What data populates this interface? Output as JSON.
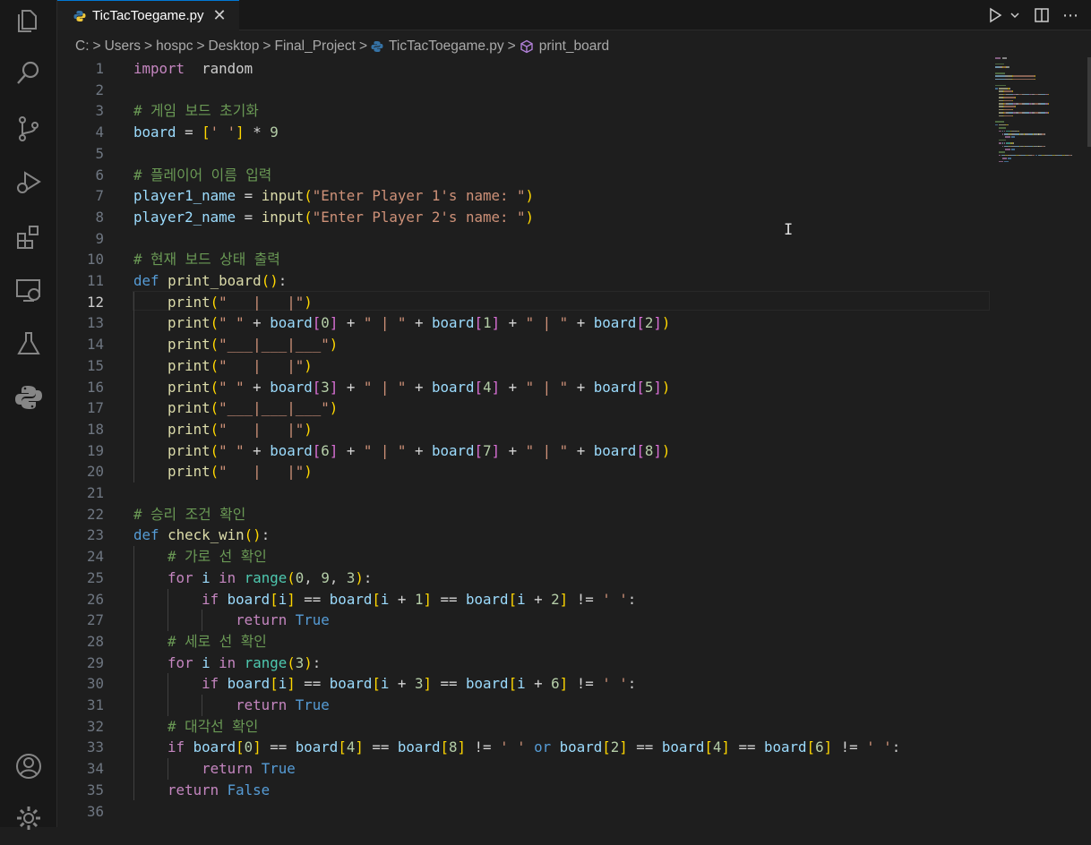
{
  "tab": {
    "title": "TicTacToegame.py",
    "close": "✕"
  },
  "tab_actions": {
    "run": "▷",
    "run_menu": "⌄",
    "split": "◫",
    "more": "⋯"
  },
  "breadcrumb": [
    "C:",
    "Users",
    "hospc",
    "Desktop",
    "Final_Project",
    "TicTacToegame.py",
    "print_board"
  ],
  "breadcrumb_sep": ">",
  "active_line": 12,
  "colors": {
    "background": "#1e1e1e",
    "activitybar": "#181818",
    "accent": "#0078d4",
    "python_blue": "#3572a5"
  },
  "code_lines": [
    [
      [
        "kw",
        "import"
      ],
      [
        "",
        "  "
      ],
      [
        "",
        "random"
      ]
    ],
    [],
    [
      [
        "cm",
        "# 게임 보드 초기화"
      ]
    ],
    [
      [
        "var",
        "board"
      ],
      [
        "op",
        " = "
      ],
      [
        "b1",
        "["
      ],
      [
        "str",
        "' '"
      ],
      [
        "b1",
        "]"
      ],
      [
        "op",
        " * "
      ],
      [
        "num",
        "9"
      ]
    ],
    [],
    [
      [
        "cm",
        "# 플레이어 이름 입력"
      ]
    ],
    [
      [
        "var",
        "player1_name"
      ],
      [
        "op",
        " = "
      ],
      [
        "fn",
        "input"
      ],
      [
        "b1",
        "("
      ],
      [
        "str",
        "\"Enter Player 1's name: \""
      ],
      [
        "b1",
        ")"
      ]
    ],
    [
      [
        "var",
        "player2_name"
      ],
      [
        "op",
        " = "
      ],
      [
        "fn",
        "input"
      ],
      [
        "b1",
        "("
      ],
      [
        "str",
        "\"Enter Player 2's name: \""
      ],
      [
        "b1",
        ")"
      ]
    ],
    [],
    [
      [
        "cm",
        "# 현재 보드 상태 출력"
      ]
    ],
    [
      [
        "def",
        "def"
      ],
      [
        "",
        " "
      ],
      [
        "fn",
        "print_board"
      ],
      [
        "b1",
        "()"
      ],
      [
        "",
        ":"
      ]
    ],
    [
      [
        "",
        "    "
      ],
      [
        "fn",
        "print"
      ],
      [
        "b1",
        "("
      ],
      [
        "str",
        "\"   |   |\""
      ],
      [
        "b1",
        ")"
      ]
    ],
    [
      [
        "",
        "    "
      ],
      [
        "fn",
        "print"
      ],
      [
        "b1",
        "("
      ],
      [
        "str",
        "\" \""
      ],
      [
        "op",
        " + "
      ],
      [
        "var",
        "board"
      ],
      [
        "b2",
        "["
      ],
      [
        "num",
        "0"
      ],
      [
        "b2",
        "]"
      ],
      [
        "op",
        " + "
      ],
      [
        "str",
        "\" | \""
      ],
      [
        "op",
        " + "
      ],
      [
        "var",
        "board"
      ],
      [
        "b2",
        "["
      ],
      [
        "num",
        "1"
      ],
      [
        "b2",
        "]"
      ],
      [
        "op",
        " + "
      ],
      [
        "str",
        "\" | \""
      ],
      [
        "op",
        " + "
      ],
      [
        "var",
        "board"
      ],
      [
        "b2",
        "["
      ],
      [
        "num",
        "2"
      ],
      [
        "b2",
        "]"
      ],
      [
        "b1",
        ")"
      ]
    ],
    [
      [
        "",
        "    "
      ],
      [
        "fn",
        "print"
      ],
      [
        "b1",
        "("
      ],
      [
        "str",
        "\"___|___|___\""
      ],
      [
        "b1",
        ")"
      ]
    ],
    [
      [
        "",
        "    "
      ],
      [
        "fn",
        "print"
      ],
      [
        "b1",
        "("
      ],
      [
        "str",
        "\"   |   |\""
      ],
      [
        "b1",
        ")"
      ]
    ],
    [
      [
        "",
        "    "
      ],
      [
        "fn",
        "print"
      ],
      [
        "b1",
        "("
      ],
      [
        "str",
        "\" \""
      ],
      [
        "op",
        " + "
      ],
      [
        "var",
        "board"
      ],
      [
        "b2",
        "["
      ],
      [
        "num",
        "3"
      ],
      [
        "b2",
        "]"
      ],
      [
        "op",
        " + "
      ],
      [
        "str",
        "\" | \""
      ],
      [
        "op",
        " + "
      ],
      [
        "var",
        "board"
      ],
      [
        "b2",
        "["
      ],
      [
        "num",
        "4"
      ],
      [
        "b2",
        "]"
      ],
      [
        "op",
        " + "
      ],
      [
        "str",
        "\" | \""
      ],
      [
        "op",
        " + "
      ],
      [
        "var",
        "board"
      ],
      [
        "b2",
        "["
      ],
      [
        "num",
        "5"
      ],
      [
        "b2",
        "]"
      ],
      [
        "b1",
        ")"
      ]
    ],
    [
      [
        "",
        "    "
      ],
      [
        "fn",
        "print"
      ],
      [
        "b1",
        "("
      ],
      [
        "str",
        "\"___|___|___\""
      ],
      [
        "b1",
        ")"
      ]
    ],
    [
      [
        "",
        "    "
      ],
      [
        "fn",
        "print"
      ],
      [
        "b1",
        "("
      ],
      [
        "str",
        "\"   |   |\""
      ],
      [
        "b1",
        ")"
      ]
    ],
    [
      [
        "",
        "    "
      ],
      [
        "fn",
        "print"
      ],
      [
        "b1",
        "("
      ],
      [
        "str",
        "\" \""
      ],
      [
        "op",
        " + "
      ],
      [
        "var",
        "board"
      ],
      [
        "b2",
        "["
      ],
      [
        "num",
        "6"
      ],
      [
        "b2",
        "]"
      ],
      [
        "op",
        " + "
      ],
      [
        "str",
        "\" | \""
      ],
      [
        "op",
        " + "
      ],
      [
        "var",
        "board"
      ],
      [
        "b2",
        "["
      ],
      [
        "num",
        "7"
      ],
      [
        "b2",
        "]"
      ],
      [
        "op",
        " + "
      ],
      [
        "str",
        "\" | \""
      ],
      [
        "op",
        " + "
      ],
      [
        "var",
        "board"
      ],
      [
        "b2",
        "["
      ],
      [
        "num",
        "8"
      ],
      [
        "b2",
        "]"
      ],
      [
        "b1",
        ")"
      ]
    ],
    [
      [
        "",
        "    "
      ],
      [
        "fn",
        "print"
      ],
      [
        "b1",
        "("
      ],
      [
        "str",
        "\"   |   |\""
      ],
      [
        "b1",
        ")"
      ]
    ],
    [],
    [
      [
        "cm",
        "# 승리 조건 확인"
      ]
    ],
    [
      [
        "def",
        "def"
      ],
      [
        "",
        " "
      ],
      [
        "fn",
        "check_win"
      ],
      [
        "b1",
        "()"
      ],
      [
        "",
        ":"
      ]
    ],
    [
      [
        "",
        "    "
      ],
      [
        "cm",
        "# 가로 선 확인"
      ]
    ],
    [
      [
        "",
        "    "
      ],
      [
        "kw",
        "for"
      ],
      [
        "",
        " "
      ],
      [
        "var",
        "i"
      ],
      [
        "",
        " "
      ],
      [
        "kw",
        "in"
      ],
      [
        "",
        " "
      ],
      [
        "bi",
        "range"
      ],
      [
        "b1",
        "("
      ],
      [
        "num",
        "0"
      ],
      [
        "",
        ", "
      ],
      [
        "num",
        "9"
      ],
      [
        "",
        ", "
      ],
      [
        "num",
        "3"
      ],
      [
        "b1",
        ")"
      ],
      [
        "",
        ":"
      ]
    ],
    [
      [
        "",
        "        "
      ],
      [
        "kw",
        "if"
      ],
      [
        "",
        " "
      ],
      [
        "var",
        "board"
      ],
      [
        "b1",
        "["
      ],
      [
        "var",
        "i"
      ],
      [
        "b1",
        "]"
      ],
      [
        "op",
        " == "
      ],
      [
        "var",
        "board"
      ],
      [
        "b1",
        "["
      ],
      [
        "var",
        "i"
      ],
      [
        "op",
        " + "
      ],
      [
        "num",
        "1"
      ],
      [
        "b1",
        "]"
      ],
      [
        "op",
        " == "
      ],
      [
        "var",
        "board"
      ],
      [
        "b1",
        "["
      ],
      [
        "var",
        "i"
      ],
      [
        "op",
        " + "
      ],
      [
        "num",
        "2"
      ],
      [
        "b1",
        "]"
      ],
      [
        "op",
        " != "
      ],
      [
        "str",
        "' '"
      ],
      [
        "",
        ":"
      ]
    ],
    [
      [
        "",
        "            "
      ],
      [
        "kw",
        "return"
      ],
      [
        "",
        " "
      ],
      [
        "def",
        "True"
      ]
    ],
    [
      [
        "",
        "    "
      ],
      [
        "cm",
        "# 세로 선 확인"
      ]
    ],
    [
      [
        "",
        "    "
      ],
      [
        "kw",
        "for"
      ],
      [
        "",
        " "
      ],
      [
        "var",
        "i"
      ],
      [
        "",
        " "
      ],
      [
        "kw",
        "in"
      ],
      [
        "",
        " "
      ],
      [
        "bi",
        "range"
      ],
      [
        "b1",
        "("
      ],
      [
        "num",
        "3"
      ],
      [
        "b1",
        ")"
      ],
      [
        "",
        ":"
      ]
    ],
    [
      [
        "",
        "        "
      ],
      [
        "kw",
        "if"
      ],
      [
        "",
        " "
      ],
      [
        "var",
        "board"
      ],
      [
        "b1",
        "["
      ],
      [
        "var",
        "i"
      ],
      [
        "b1",
        "]"
      ],
      [
        "op",
        " == "
      ],
      [
        "var",
        "board"
      ],
      [
        "b1",
        "["
      ],
      [
        "var",
        "i"
      ],
      [
        "op",
        " + "
      ],
      [
        "num",
        "3"
      ],
      [
        "b1",
        "]"
      ],
      [
        "op",
        " == "
      ],
      [
        "var",
        "board"
      ],
      [
        "b1",
        "["
      ],
      [
        "var",
        "i"
      ],
      [
        "op",
        " + "
      ],
      [
        "num",
        "6"
      ],
      [
        "b1",
        "]"
      ],
      [
        "op",
        " != "
      ],
      [
        "str",
        "' '"
      ],
      [
        "",
        ":"
      ]
    ],
    [
      [
        "",
        "            "
      ],
      [
        "kw",
        "return"
      ],
      [
        "",
        " "
      ],
      [
        "def",
        "True"
      ]
    ],
    [
      [
        "",
        "    "
      ],
      [
        "cm",
        "# 대각선 확인"
      ]
    ],
    [
      [
        "",
        "    "
      ],
      [
        "kw",
        "if"
      ],
      [
        "",
        " "
      ],
      [
        "var",
        "board"
      ],
      [
        "b1",
        "["
      ],
      [
        "num",
        "0"
      ],
      [
        "b1",
        "]"
      ],
      [
        "op",
        " == "
      ],
      [
        "var",
        "board"
      ],
      [
        "b1",
        "["
      ],
      [
        "num",
        "4"
      ],
      [
        "b1",
        "]"
      ],
      [
        "op",
        " == "
      ],
      [
        "var",
        "board"
      ],
      [
        "b1",
        "["
      ],
      [
        "num",
        "8"
      ],
      [
        "b1",
        "]"
      ],
      [
        "op",
        " != "
      ],
      [
        "str",
        "' '"
      ],
      [
        "",
        " "
      ],
      [
        "def",
        "or"
      ],
      [
        "",
        " "
      ],
      [
        "var",
        "board"
      ],
      [
        "b1",
        "["
      ],
      [
        "num",
        "2"
      ],
      [
        "b1",
        "]"
      ],
      [
        "op",
        " == "
      ],
      [
        "var",
        "board"
      ],
      [
        "b1",
        "["
      ],
      [
        "num",
        "4"
      ],
      [
        "b1",
        "]"
      ],
      [
        "op",
        " == "
      ],
      [
        "var",
        "board"
      ],
      [
        "b1",
        "["
      ],
      [
        "num",
        "6"
      ],
      [
        "b1",
        "]"
      ],
      [
        "op",
        " != "
      ],
      [
        "str",
        "' '"
      ],
      [
        "",
        ":"
      ]
    ],
    [
      [
        "",
        "        "
      ],
      [
        "kw",
        "return"
      ],
      [
        "",
        " "
      ],
      [
        "def",
        "True"
      ]
    ],
    [
      [
        "",
        "    "
      ],
      [
        "kw",
        "return"
      ],
      [
        "",
        " "
      ],
      [
        "def",
        "False"
      ]
    ],
    []
  ]
}
